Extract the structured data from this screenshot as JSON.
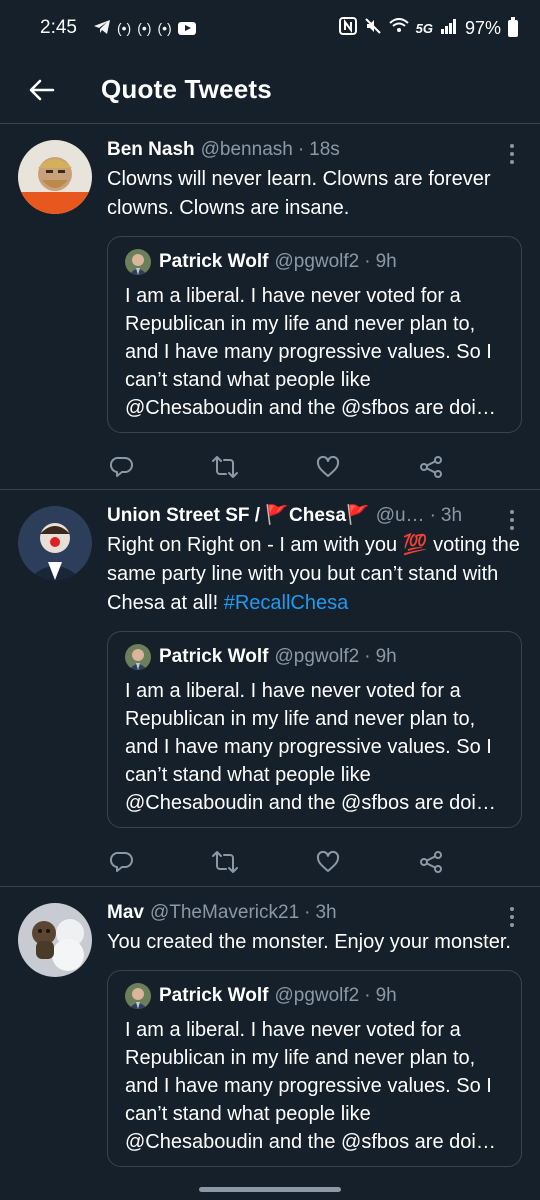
{
  "status_bar": {
    "time": "2:45",
    "network": "5G",
    "battery": "97%"
  },
  "header": {
    "title": "Quote Tweets"
  },
  "quoted_tweet": {
    "name": "Patrick Wolf",
    "handle": "@pgwolf2",
    "time": "9h",
    "text": "I am a liberal. I have never voted for a Republican in my life and never plan to, and I have many progressive values. So I can’t stand what people like @Chesaboudin and the @sfbos are doi…"
  },
  "tweets": [
    {
      "name": "Ben Nash",
      "handle": "@bennash",
      "time": "18s",
      "text": "Clowns will never learn. Clowns are forever clowns. Clowns are insane."
    },
    {
      "name": "Union Street SF / 🚩Chesa🚩",
      "handle": "@u…",
      "time": "3h",
      "text": "Right on Right on - I am with you 💯 voting the same party line with you but can’t stand with Chesa at all!",
      "hashtag": "#RecallChesa"
    },
    {
      "name": "Mav",
      "handle": "@TheMaverick21",
      "time": "3h",
      "text": "You created the monster. Enjoy your monster."
    }
  ],
  "icons": {
    "back": "arrow-left-icon",
    "more": "more-vertical-icon",
    "reply": "reply-icon",
    "retweet": "retweet-icon",
    "like": "heart-icon",
    "share": "share-icon"
  },
  "colors": {
    "background": "#15202b",
    "border": "#38444d",
    "secondary_text": "#8b98a5",
    "link": "#1d9bf0"
  }
}
